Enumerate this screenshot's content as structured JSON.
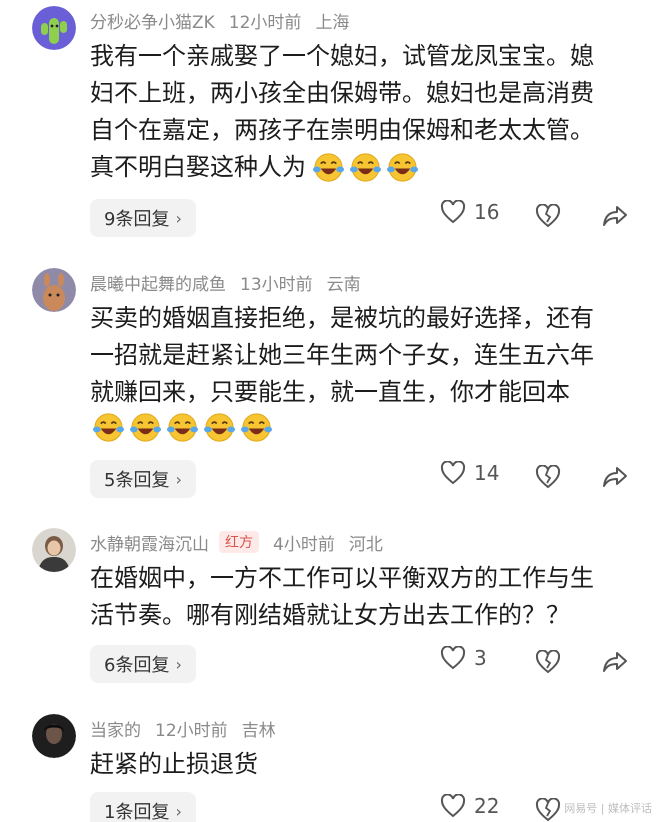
{
  "comments": [
    {
      "username": "分秒必争小猫ZK",
      "time": "12小时前",
      "location": "上海",
      "avatar_icon": "cactus-avatar-icon",
      "lines": [
        "我有一个亲戚娶了一个媳妇，试管龙凤宝宝。媳",
        "妇不上班，两小孩全由保姆带。媳妇也是高消费",
        "自个在嘉定，两孩子在崇明由保姆和老太太管。",
        "真不明白娶这种人为"
      ],
      "emoji_count": 3,
      "reply_label": "9条回复",
      "likes": "16"
    },
    {
      "username": "晨曦中起舞的咸鱼",
      "time": "13小时前",
      "location": "云南",
      "avatar_icon": "llama-avatar-icon",
      "lines": [
        "买卖的婚姻直接拒绝，是被坑的最好选择，还有",
        "一招就是赶紧让她三年生两个子女，连生五六年",
        "就赚回来，只要能生，就一直生，你才能回本"
      ],
      "emoji_count": 5,
      "reply_label": "5条回复",
      "likes": "14"
    },
    {
      "username": "水静朝霞海沉山",
      "tag": "红方",
      "time": "4小时前",
      "location": "河北",
      "avatar_icon": "photo-avatar-icon",
      "lines": [
        "在婚姻中，一方不工作可以平衡双方的工作与生",
        "活节奏。哪有刚结婚就让女方出去工作的？？"
      ],
      "emoji_count": 0,
      "reply_label": "6条回复",
      "likes": "3"
    },
    {
      "username": "当家的",
      "time": "12小时前",
      "location": "吉林",
      "avatar_icon": "portrait-avatar-icon",
      "lines": [
        "赶紧的止损退货"
      ],
      "emoji_count": 0,
      "reply_label": "1条回复",
      "likes": "22"
    }
  ],
  "watermark": "网易号 | 媒体评话",
  "colors": {
    "text": "#1c1c1c",
    "meta": "#8a8a8a",
    "tag_text": "#d9534f",
    "tag_bg": "#fde9e7",
    "reply_bg": "#f2f2f2",
    "emoji_face": "#f7c531"
  }
}
